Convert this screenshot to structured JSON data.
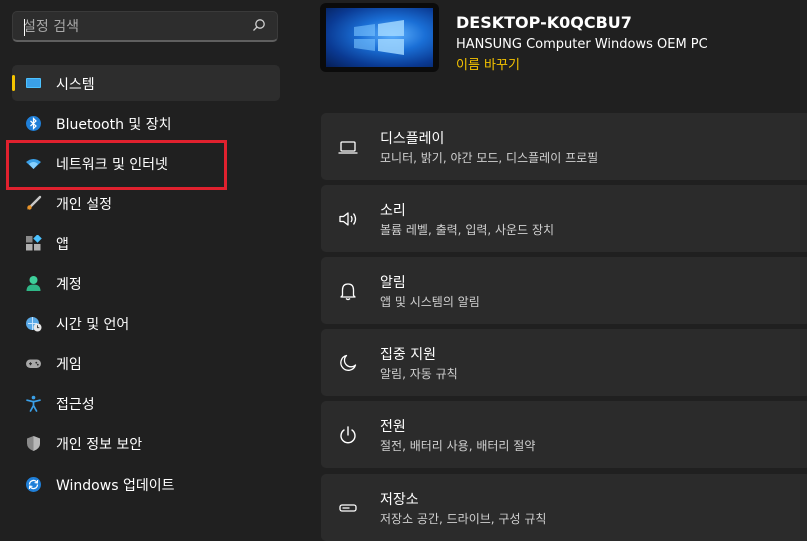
{
  "search": {
    "placeholder": "설정 검색"
  },
  "sidebar": {
    "items": [
      {
        "label": "시스템",
        "icon": "system-icon",
        "selected": true
      },
      {
        "label": "Bluetooth 및 장치",
        "icon": "bluetooth-icon"
      },
      {
        "label": "네트워크 및 인터넷",
        "icon": "wifi-icon"
      },
      {
        "label": "개인 설정",
        "icon": "brush-icon"
      },
      {
        "label": "앱",
        "icon": "apps-icon"
      },
      {
        "label": "계정",
        "icon": "account-icon"
      },
      {
        "label": "시간 및 언어",
        "icon": "time-language-icon"
      },
      {
        "label": "게임",
        "icon": "gaming-icon"
      },
      {
        "label": "접근성",
        "icon": "accessibility-icon"
      },
      {
        "label": "개인 정보 보안",
        "icon": "shield-icon"
      },
      {
        "label": "Windows 업데이트",
        "icon": "update-icon"
      }
    ]
  },
  "device": {
    "name": "DESKTOP-K0QCBU7",
    "model": "HANSUNG Computer Windows OEM PC",
    "rename": "이름 바꾸기"
  },
  "cards": [
    {
      "title": "디스플레이",
      "subtitle": "모니터, 밝기, 야간 모드, 디스플레이 프로필",
      "icon": "display-icon"
    },
    {
      "title": "소리",
      "subtitle": "볼륨 레벨, 출력, 입력, 사운드 장치",
      "icon": "speaker-icon"
    },
    {
      "title": "알림",
      "subtitle": "앱 및 시스템의 알림",
      "icon": "bell-icon"
    },
    {
      "title": "집중 지원",
      "subtitle": "알림, 자동 규칙",
      "icon": "moon-icon"
    },
    {
      "title": "전원",
      "subtitle": "절전, 배터리 사용, 배터리 절약",
      "icon": "power-icon"
    },
    {
      "title": "저장소",
      "subtitle": "저장소 공간, 드라이브, 구성 규칙",
      "icon": "storage-icon"
    }
  ],
  "colors": {
    "accent": "#f5c400",
    "highlight": "#e0212e",
    "background": "#202020",
    "card": "#2b2b2b"
  }
}
